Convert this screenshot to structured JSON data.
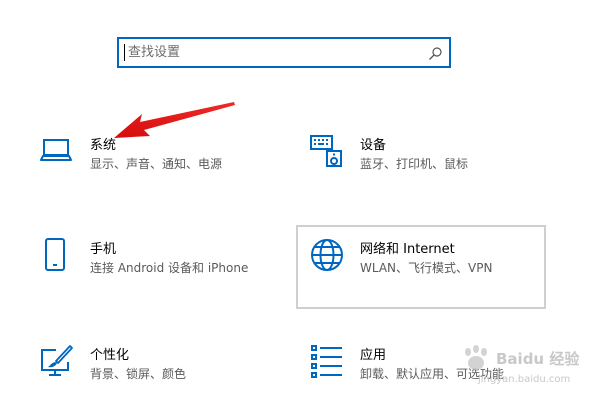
{
  "search": {
    "placeholder": "查找设置"
  },
  "categories": [
    {
      "title": "系统",
      "desc": "显示、声音、通知、电源",
      "icon": "laptop-icon"
    },
    {
      "title": "设备",
      "desc": "蓝牙、打印机、鼠标",
      "icon": "keyboard-speaker-icon"
    },
    {
      "title": "手机",
      "desc": "连接 Android 设备和 iPhone",
      "icon": "phone-icon"
    },
    {
      "title": "网络和 Internet",
      "desc": "WLAN、飞行模式、VPN",
      "icon": "globe-icon"
    },
    {
      "title": "个性化",
      "desc": "背景、锁屏、颜色",
      "icon": "paint-monitor-icon"
    },
    {
      "title": "应用",
      "desc": "卸载、默认应用、可选功能",
      "icon": "app-list-icon"
    }
  ],
  "watermark": {
    "text": "Baidu 经验",
    "sub": "jingyan.baidu.com"
  },
  "colors": {
    "accent": "#0067c0",
    "arrow": "#e01010",
    "hover_border": "#cfcfcf"
  }
}
